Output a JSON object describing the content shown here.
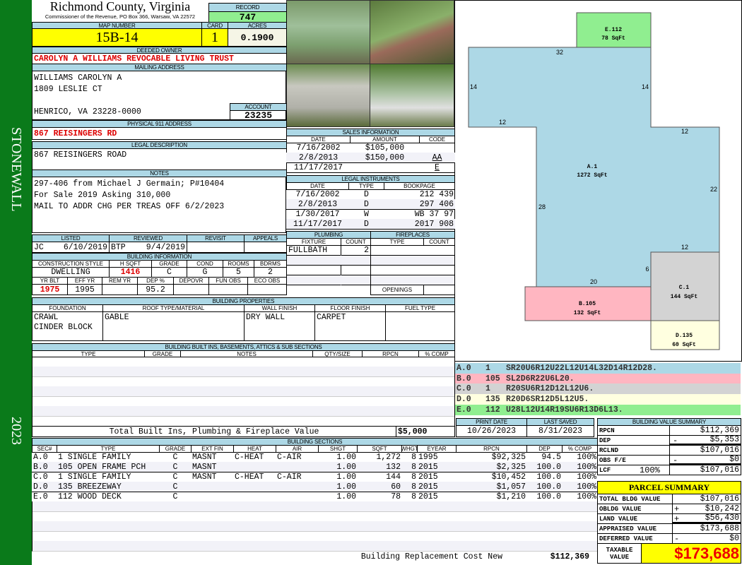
{
  "sidebar": {
    "district": "STONEWALL",
    "year": "2023"
  },
  "header": {
    "county": "Richmond County, Virginia",
    "subtitle": "Commissioner of the Revenue, PO Box 366, Warsaw, VA 22572",
    "record_label": "RECORD",
    "record": "747"
  },
  "parcel": {
    "map_label": "MAP NUMBER",
    "map": "15B-14",
    "card_label": "CARD",
    "card": "1",
    "acres_label": "ACRES",
    "acres": "0.1900"
  },
  "owner": {
    "label": "DEEDED OWNER",
    "name": "CAROLYN A WILLIAMS REVOCABLE LIVING TRUST"
  },
  "mailing": {
    "label": "MAILING ADDRESS",
    "line1": "WILLIAMS CAROLYN A",
    "line2": "1809 LESLIE CT",
    "line3": "HENRICO, VA 23228-0000",
    "account_label": "ACCOUNT",
    "account": "23235"
  },
  "physical": {
    "label": "PHYSICAL 911 ADDRESS",
    "value": "867 REISINGERS RD"
  },
  "legal": {
    "label": "LEGAL DESCRIPTION",
    "value": "867 REISINGERS ROAD"
  },
  "notes": {
    "label": "NOTES",
    "lines": [
      "297-406 from Michael J Germain; P#10404",
      "For Sale 2019 Asking 310,000",
      "MAIL TO ADDR CHG PER TREAS OFF 6/2/2023"
    ]
  },
  "review": {
    "headers": [
      "LISTED",
      "REVIEWED",
      "REVISIT",
      "APPEALS"
    ],
    "listed_by": "JC",
    "listed_date": "6/10/2019",
    "reviewed_by": "BTP",
    "reviewed_date": "9/4/2019"
  },
  "building_info": {
    "label": "BUILDING INFORMATION",
    "headers1": [
      "CONSTRUCTION STYLE",
      "H SQFT",
      "GRADE",
      "COND",
      "ROOMS",
      "BDRMS"
    ],
    "values1": [
      "DWELLING",
      "1416",
      "C",
      "G",
      "5",
      "2"
    ],
    "headers2": [
      "YR BLT",
      "EFF YR",
      "REM YR",
      "DEP %",
      "DEPOVR",
      "FUN OBS",
      "ECO OBS"
    ],
    "values2": [
      "1975",
      "1995",
      "",
      "95.2",
      "",
      "",
      ""
    ]
  },
  "sales": {
    "label": "SALES INFORMATION",
    "headers": [
      "DATE",
      "AMOUNT",
      "CODE"
    ],
    "rows": [
      [
        "7/16/2002",
        "$105,000",
        ""
      ],
      [
        "2/8/2013",
        "$150,000",
        "AA"
      ],
      [
        "11/17/2017",
        "",
        "E"
      ]
    ]
  },
  "instruments": {
    "label": "LEGAL INSTRUMENTS",
    "headers": [
      "DATE",
      "TYPE",
      "BOOKPAGE"
    ],
    "rows": [
      [
        "7/16/2002",
        "D",
        "212 439"
      ],
      [
        "2/8/2013",
        "D",
        "297 406"
      ],
      [
        "1/30/2017",
        "W",
        "WB 37 97"
      ],
      [
        "11/17/2017",
        "D",
        "2017 908"
      ]
    ]
  },
  "plumbing": {
    "label": "PLUMBING",
    "headers": [
      "FIXTURE",
      "COUNT"
    ],
    "rows": [
      [
        "FULLBATH",
        "2"
      ]
    ]
  },
  "fireplaces": {
    "label": "FIREPLACES",
    "headers": [
      "TYPE",
      "COUNT"
    ],
    "openings_label": "OPENINGS"
  },
  "properties": {
    "label": "BUILDING PROPERTIES",
    "headers": [
      "FOUNDATION",
      "ROOF TYPE/MATERIAL",
      "WALL FINISH",
      "FLOOR FINISH",
      "FUEL TYPE"
    ],
    "values": [
      "CRAWL\nCINDER BLOCK",
      "GABLE",
      "DRY WALL",
      "CARPET",
      ""
    ]
  },
  "builtins": {
    "label": "BUILDING BUILT INS, BASEMENTS, ATTICS & SUB SECTIONS",
    "headers": [
      "TYPE",
      "GRADE",
      "NOTES",
      "QTY/SIZE",
      "RPCN",
      "% COMP"
    ],
    "total_label": "Total Built Ins, Plumbing & Fireplace Value",
    "total": "$5,000"
  },
  "dates": {
    "print_label": "PRINT DATE",
    "print": "10/26/2023",
    "saved_label": "LAST SAVED",
    "saved": "8/31/2023"
  },
  "sections": {
    "label": "BUILDING SECTIONS",
    "headers": [
      "SEC#",
      "TYPE",
      "GRADE",
      "EXT FIN",
      "HEAT",
      "AIR",
      "SHGT",
      "SQFT",
      "WHGT",
      "EYEAR",
      "RPCN",
      "DEP",
      "% COMP"
    ],
    "rows": [
      [
        "A.0",
        "1 SINGLE FAMILY",
        "C",
        "MASNT",
        "C-HEAT",
        "C-AIR",
        "1.00",
        "1,272",
        "8",
        "1995",
        "$92,325",
        "94.5",
        "100%"
      ],
      [
        "B.0",
        "105 OPEN FRAME PCH",
        "C",
        "MASNT",
        "",
        "",
        "1.00",
        "132",
        "8",
        "2015",
        "$2,325",
        "100.0",
        "100%"
      ],
      [
        "C.0",
        "1 SINGLE FAMILY",
        "C",
        "MASNT",
        "C-HEAT",
        "C-AIR",
        "1.00",
        "144",
        "8",
        "2015",
        "$10,452",
        "100.0",
        "100%"
      ],
      [
        "D.0",
        "135 BREEZEWAY",
        "C",
        "",
        "",
        "",
        "1.00",
        "60",
        "8",
        "2015",
        "$1,057",
        "100.0",
        "100%"
      ],
      [
        "E.0",
        "112 WOOD DECK",
        "C",
        "",
        "",
        "",
        "1.00",
        "78",
        "8",
        "2015",
        "$1,210",
        "100.0",
        "100%"
      ]
    ],
    "rcn_label": "Building Replacement Cost New",
    "rcn": "$112,369"
  },
  "sketch": {
    "areas": [
      {
        "id": "E.112",
        "sqft": "78 SqFt",
        "color": "#90ee90"
      },
      {
        "id": "A.1",
        "sqft": "1272 SqFt",
        "color": "#add8e6"
      },
      {
        "id": "B.105",
        "sqft": "132 SqFt",
        "color": "#ffb6c1"
      },
      {
        "id": "C.1",
        "sqft": "144 SqFt",
        "color": "#d3d3d3"
      },
      {
        "id": "D.135",
        "sqft": "60 SqFt",
        "color": "#ffffe0"
      }
    ],
    "dimensions": [
      "32",
      "14",
      "14",
      "12",
      "12",
      "22",
      "28",
      "12",
      "6",
      "20"
    ],
    "codes": [
      {
        "sec": "A.0",
        "code": "1",
        "path": "SR20U6R12U22L12U14L32D14R12D28.",
        "color": "#add8e6"
      },
      {
        "sec": "B.0",
        "code": "105",
        "path": "SL2D6R22U6L20.",
        "color": "#ffb6c1"
      },
      {
        "sec": "C.0",
        "code": "1",
        "path": "R20SU6R12D12L12U6.",
        "color": "#d3d3d3"
      },
      {
        "sec": "D.0",
        "code": "135",
        "path": "R20D6SR12D5L12U5.",
        "color": "#ffffe0"
      },
      {
        "sec": "E.0",
        "code": "112",
        "path": "U28L12U14R19SU6R13D6L13.",
        "color": "#90ee90"
      }
    ]
  },
  "value_summary": {
    "label": "BUILDING VALUE SUMMARY",
    "rows": [
      {
        "label": "RPCN",
        "sign": "",
        "value": "$112,369"
      },
      {
        "label": "DEP",
        "sign": "-",
        "value": "$5,353"
      },
      {
        "label": "RCLND",
        "sign": "",
        "value": "$107,016"
      },
      {
        "label": "OBS F/E",
        "sign": "-",
        "value": "$0"
      },
      {
        "label": "LCF",
        "sign": "",
        "value": "$107,016"
      }
    ],
    "lcf_pct": "100%"
  },
  "parcel_summary": {
    "title": "PARCEL SUMMARY",
    "rows": [
      {
        "label": "TOTAL BLDG VALUE",
        "sign": "",
        "value": "$107,016"
      },
      {
        "label": "OBLDG VALUE",
        "sign": "+",
        "value": "$10,242"
      },
      {
        "label": "LAND VALUE",
        "sign": "+",
        "value": "$56,430"
      },
      {
        "label": "APPRAISED VALUE",
        "sign": "",
        "value": "$173,688"
      },
      {
        "label": "DEFERRED VALUE",
        "sign": "-",
        "value": "$0"
      }
    ],
    "taxable_label": "TAXABLE VALUE",
    "taxable": "$173,688"
  }
}
